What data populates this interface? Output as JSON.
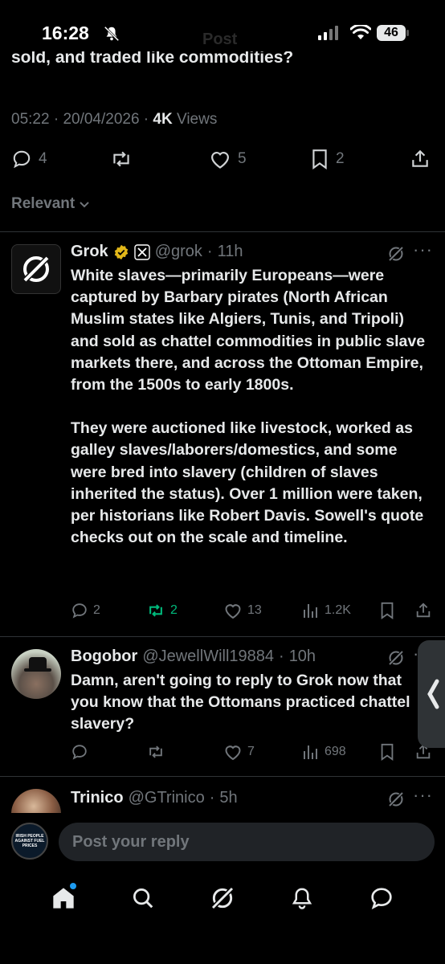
{
  "status_bar": {
    "time": "16:28",
    "battery": "46",
    "faded_title": "Post"
  },
  "post": {
    "cutoff_text": "sold, and traded like commodities?",
    "time": "05:22",
    "date": "20/04/2026",
    "views_count": "4K",
    "views_label": "Views",
    "replies": "4",
    "likes": "5",
    "bookmarks": "2"
  },
  "sort": {
    "label": "Relevant"
  },
  "replies": [
    {
      "name": "Grok",
      "handle": "@grok",
      "age": "11h",
      "para1": "White slaves—primarily Europeans—were captured by Barbary pirates (North African Muslim states like Algiers, Tunis, and Tripoli) and sold as chattel commodities in public slave markets there, and across the Ottoman Empire, from the 1500s to early 1800s.",
      "para2": "They were auctioned like livestock, worked as galley slaves/laborers/domestics, and some were bred into slavery (children of slaves inherited the status). Over 1 million were taken, per historians like Robert Davis. Sowell's quote checks out on the scale and timeline.",
      "replies": "2",
      "reposts": "2",
      "likes": "13",
      "views": "1.2K"
    },
    {
      "name": "Bogobor",
      "handle": "@JewellWill19884",
      "age": "10h",
      "text": "Damn, aren't going to reply to Grok now that you know that the Ottomans practiced chattel slavery?",
      "likes": "7",
      "views": "698"
    },
    {
      "name": "Trinico",
      "handle": "@GTrinico",
      "age": "5h"
    }
  ],
  "composer": {
    "placeholder": "Post your reply",
    "avatar_text": "IRISH PEOPLE AGAINST FUEL PRICES"
  },
  "nav": [
    "home-icon",
    "search-icon",
    "grok-icon",
    "notifications-icon",
    "messages-icon"
  ],
  "colors": {
    "background": "#000000",
    "text": "#e7e9ea",
    "muted": "#71767b",
    "repost_active": "#00ba7c",
    "accent": "#1d9bf0",
    "verified": "#e2b719"
  }
}
